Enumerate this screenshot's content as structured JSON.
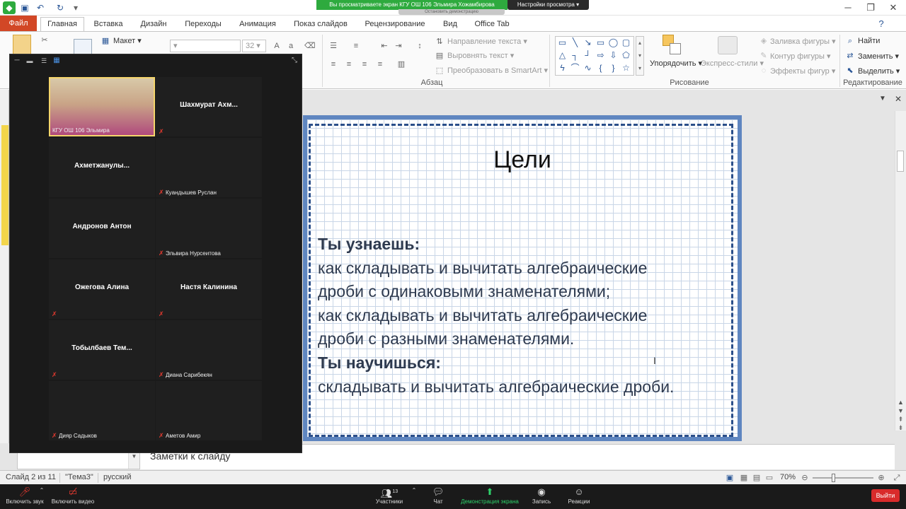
{
  "share_banner": {
    "text": "Вы просматриваете экран КГУ ОШ 106 Эльмира Хожамбирова",
    "subtext": "Остановить демонстрацию",
    "view_settings": "Настройки просмотра"
  },
  "ribbon_tabs": [
    "Файл",
    "Главная",
    "Вставка",
    "Дизайн",
    "Переходы",
    "Анимация",
    "Показ слайдов",
    "Рецензирование",
    "Вид",
    "Office Tab"
  ],
  "ribbon": {
    "layout_label": "Макет",
    "font_size": "32",
    "text_direction": "Направление текста",
    "align_text": "Выровнять текст",
    "convert_smartart": "Преобразовать в SmartArt",
    "paragraph_group": "Абзац",
    "arrange": "Упорядочить",
    "quick_styles": "Экспресс-стили",
    "shape_fill": "Заливка фигуры",
    "shape_outline": "Контур фигуры",
    "shape_effects": "Эффекты фигур",
    "drawing_group": "Рисование",
    "find": "Найти",
    "replace": "Заменить",
    "select": "Выделить",
    "editing_group": "Редактирование"
  },
  "slide": {
    "title": "Цели",
    "lines": [
      {
        "text": "Ты узнаешь:",
        "bold": true
      },
      {
        "text": "как складывать и вычитать алгебраические",
        "bold": false
      },
      {
        "text": "дроби с одинаковыми знаменателями;",
        "bold": false
      },
      {
        "text": "как складывать и вычитать алгебраические",
        "bold": false
      },
      {
        "text": "дроби с разными знаменателями.",
        "bold": false
      },
      {
        "text": "Ты научишься:",
        "bold": true
      },
      {
        "text": "складывать и вычитать алгебраические дроби.",
        "bold": false
      }
    ]
  },
  "notes_placeholder": "Заметки к слайду",
  "status": {
    "slide": "Слайд 2 из 11",
    "theme": "\"Тема3\"",
    "language": "русский",
    "zoom": "70%"
  },
  "participants": [
    {
      "label": "КГУ ОШ 106 Эльмира",
      "has_video": true,
      "muted": false,
      "active": true,
      "photo": "woman-video"
    },
    {
      "label": "Шахмурат  Ахм...",
      "has_video": false,
      "muted": true
    },
    {
      "label": "Ахметжанулы...",
      "has_video": false,
      "muted": false
    },
    {
      "label": "Куандышев Руслан",
      "has_video": true,
      "muted": true,
      "photo": "boy-avatar"
    },
    {
      "label": "Андронов Антон",
      "has_video": false,
      "muted": false
    },
    {
      "label": "Эльвира Нурсеитова",
      "has_video": true,
      "muted": true,
      "photo": "girl-avatar"
    },
    {
      "label": "Ожегова Алина",
      "has_video": false,
      "muted": true
    },
    {
      "label": "Настя Калинина",
      "has_video": false,
      "muted": true
    },
    {
      "label": "Тобылбаев  Тем...",
      "has_video": false,
      "muted": true
    },
    {
      "label": "Диана Сарибекян",
      "has_video": true,
      "muted": true,
      "photo": "anime-avatar"
    },
    {
      "label": "Дияр Садыков",
      "has_video": true,
      "muted": true,
      "photo": "cat-avatar"
    },
    {
      "label": "Аметов Амир",
      "has_video": true,
      "muted": true,
      "photo": "doll-avatar"
    }
  ],
  "zoom_toolbar": {
    "mute": "Включить звук",
    "video": "Включить видео",
    "participants": "Участники",
    "participants_count": "13",
    "chat": "Чат",
    "share": "Демонстрация экрана",
    "record": "Запись",
    "reactions": "Реакции",
    "leave": "Выйти"
  },
  "colors": {
    "file_tab": "#d24726",
    "share_green": "#2eaa3e",
    "slide_border": "#5f86c0",
    "leave_red": "#d92b2b"
  }
}
